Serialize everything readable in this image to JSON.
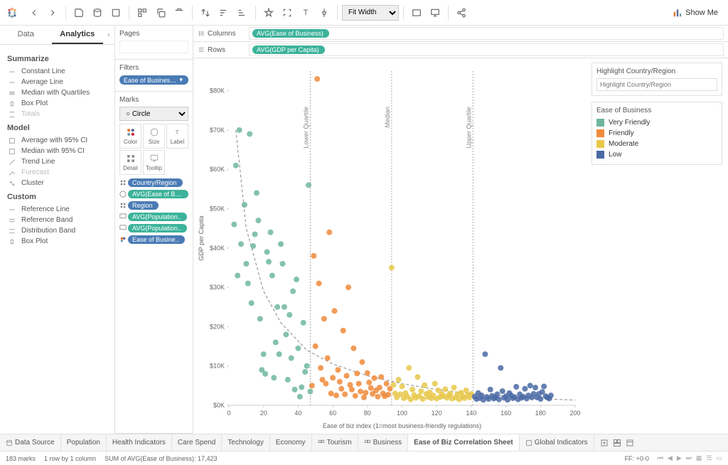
{
  "toolbar": {
    "fit_select": "Fit Width",
    "showme": "Show Me"
  },
  "left_tabs": {
    "data": "Data",
    "analytics": "Analytics"
  },
  "analytics": {
    "summarize": {
      "title": "Summarize",
      "items": [
        "Constant Line",
        "Average Line",
        "Median with Quartiles",
        "Box Plot",
        "Totals"
      ]
    },
    "model": {
      "title": "Model",
      "items": [
        "Average with 95% CI",
        "Median with 95% CI",
        "Trend Line",
        "Forecast",
        "Cluster"
      ]
    },
    "custom": {
      "title": "Custom",
      "items": [
        "Reference Line",
        "Reference Band",
        "Distribution Band",
        "Box Plot"
      ]
    }
  },
  "panels": {
    "pages": "Pages",
    "filters": "Filters",
    "filter_pill": "Ease of Business (cl..",
    "marks": "Marks",
    "mark_type": "Circle",
    "mark_cells": [
      "Color",
      "Size",
      "Label",
      "Detail",
      "Tooltip"
    ],
    "mark_pills": [
      {
        "color": "blue",
        "label": "Country/Region",
        "ind": "detail"
      },
      {
        "color": "green",
        "label": "AVG(Ease of Busi..",
        "ind": "size"
      },
      {
        "color": "blue",
        "label": "Region",
        "ind": "detail"
      },
      {
        "color": "green",
        "label": "AVG(Population..",
        "ind": "tooltip"
      },
      {
        "color": "green",
        "label": "AVG(Population..",
        "ind": "tooltip"
      },
      {
        "color": "blue",
        "label": "Ease of Busine..",
        "ind": "color"
      }
    ]
  },
  "shelves": {
    "columns": "Columns",
    "rows": "Rows",
    "col_pill": "AVG(Ease of Business)",
    "row_pill": "AVG(GDP per Capita)"
  },
  "right": {
    "highlight_title": "Highlight Country/Region",
    "highlight_placeholder": "Highlight Country/Region",
    "legend_title": "Ease of Business",
    "legend": [
      {
        "label": "Very Friendly",
        "color": "#6fb79c"
      },
      {
        "label": "Friendly",
        "color": "#f08a3a"
      },
      {
        "label": "Moderate",
        "color": "#e8c84a"
      },
      {
        "label": "Low",
        "color": "#4a6aa5"
      }
    ]
  },
  "sheet_tabs": {
    "data_source": "Data Source",
    "items": [
      "Population",
      "Health Indicators",
      "Care Spend",
      "Technology",
      "Economy",
      "Tourism",
      "Business",
      "Ease of Biz Correlation Sheet",
      "Global Indicators"
    ],
    "active_index": 7
  },
  "status": {
    "marks": "183 marks",
    "rbc": "1 row by 1 column",
    "sum": "SUM of AVG(Ease of Business): 17,423",
    "ff": "FF: +0-0"
  },
  "chart_data": {
    "type": "scatter",
    "xlabel": "Ease of biz index (1=most business-friendly regulations)",
    "ylabel": "GDP per Capita",
    "xlim": [
      0,
      200
    ],
    "ylim": [
      0,
      85000
    ],
    "yticks": [
      0,
      10000,
      20000,
      30000,
      40000,
      50000,
      60000,
      70000,
      80000
    ],
    "ytick_labels": [
      "$0K",
      "$10K",
      "$20K",
      "$30K",
      "$40K",
      "$50K",
      "$60K",
      "$70K",
      "$80K"
    ],
    "xticks": [
      0,
      20,
      40,
      60,
      80,
      100,
      120,
      140,
      160,
      180,
      200
    ],
    "reference_lines": [
      {
        "x": 47,
        "label": "Lower Quartile"
      },
      {
        "x": 94,
        "label": "Median"
      },
      {
        "x": 141,
        "label": "Upper Quartile"
      }
    ],
    "trend": [
      {
        "x": 4,
        "y": 70000
      },
      {
        "x": 10,
        "y": 45000
      },
      {
        "x": 20,
        "y": 29000
      },
      {
        "x": 30,
        "y": 21000
      },
      {
        "x": 45,
        "y": 14000
      },
      {
        "x": 60,
        "y": 10500
      },
      {
        "x": 80,
        "y": 7500
      },
      {
        "x": 100,
        "y": 5500
      },
      {
        "x": 120,
        "y": 4000
      },
      {
        "x": 140,
        "y": 3000
      },
      {
        "x": 160,
        "y": 2300
      },
      {
        "x": 180,
        "y": 1700
      },
      {
        "x": 200,
        "y": 1300
      }
    ],
    "series": [
      {
        "name": "Very Friendly",
        "color": "#6fb79c",
        "points": [
          {
            "x": 3,
            "y": 46000
          },
          {
            "x": 4,
            "y": 61000
          },
          {
            "x": 5,
            "y": 33000
          },
          {
            "x": 6,
            "y": 70000
          },
          {
            "x": 7,
            "y": 41000
          },
          {
            "x": 9,
            "y": 51000
          },
          {
            "x": 10,
            "y": 36000
          },
          {
            "x": 11,
            "y": 31000
          },
          {
            "x": 12,
            "y": 69000
          },
          {
            "x": 13,
            "y": 26000
          },
          {
            "x": 14,
            "y": 40500
          },
          {
            "x": 15,
            "y": 43500
          },
          {
            "x": 16,
            "y": 54000
          },
          {
            "x": 17,
            "y": 47000
          },
          {
            "x": 18,
            "y": 22000
          },
          {
            "x": 19,
            "y": 9000
          },
          {
            "x": 20,
            "y": 13000
          },
          {
            "x": 21,
            "y": 8000
          },
          {
            "x": 22,
            "y": 39000
          },
          {
            "x": 23,
            "y": 36500
          },
          {
            "x": 24,
            "y": 44000
          },
          {
            "x": 25,
            "y": 33000
          },
          {
            "x": 26,
            "y": 7000
          },
          {
            "x": 27,
            "y": 16000
          },
          {
            "x": 28,
            "y": 25000
          },
          {
            "x": 29,
            "y": 13000
          },
          {
            "x": 30,
            "y": 41000
          },
          {
            "x": 31,
            "y": 36000
          },
          {
            "x": 32,
            "y": 25000
          },
          {
            "x": 33,
            "y": 18000
          },
          {
            "x": 34,
            "y": 6500
          },
          {
            "x": 35,
            "y": 23000
          },
          {
            "x": 36,
            "y": 12000
          },
          {
            "x": 37,
            "y": 29000
          },
          {
            "x": 38,
            "y": 4000
          },
          {
            "x": 39,
            "y": 32000
          },
          {
            "x": 40,
            "y": 14500
          },
          {
            "x": 41,
            "y": 2200
          },
          {
            "x": 42,
            "y": 4600
          },
          {
            "x": 43,
            "y": 21000
          },
          {
            "x": 44,
            "y": 8500
          },
          {
            "x": 45,
            "y": 10000
          },
          {
            "x": 46,
            "y": 56000
          },
          {
            "x": 47,
            "y": 3500
          }
        ]
      },
      {
        "name": "Friendly",
        "color": "#f08a3a",
        "points": [
          {
            "x": 48,
            "y": 5000
          },
          {
            "x": 49,
            "y": 38000
          },
          {
            "x": 50,
            "y": 15000
          },
          {
            "x": 51,
            "y": 83000
          },
          {
            "x": 52,
            "y": 31000
          },
          {
            "x": 53,
            "y": 9500
          },
          {
            "x": 54,
            "y": 6500
          },
          {
            "x": 55,
            "y": 22000
          },
          {
            "x": 56,
            "y": 5500
          },
          {
            "x": 57,
            "y": 12000
          },
          {
            "x": 58,
            "y": 44000
          },
          {
            "x": 59,
            "y": 3000
          },
          {
            "x": 60,
            "y": 7000
          },
          {
            "x": 61,
            "y": 24000
          },
          {
            "x": 62,
            "y": 2500
          },
          {
            "x": 63,
            "y": 9000
          },
          {
            "x": 64,
            "y": 6000
          },
          {
            "x": 65,
            "y": 4200
          },
          {
            "x": 66,
            "y": 19000
          },
          {
            "x": 67,
            "y": 2800
          },
          {
            "x": 68,
            "y": 7500
          },
          {
            "x": 69,
            "y": 30000
          },
          {
            "x": 70,
            "y": 5200
          },
          {
            "x": 71,
            "y": 4000
          },
          {
            "x": 72,
            "y": 14500
          },
          {
            "x": 73,
            "y": 2400
          },
          {
            "x": 74,
            "y": 8100
          },
          {
            "x": 75,
            "y": 5500
          },
          {
            "x": 76,
            "y": 3500
          },
          {
            "x": 77,
            "y": 11000
          },
          {
            "x": 78,
            "y": 2000
          },
          {
            "x": 79,
            "y": 3200
          },
          {
            "x": 80,
            "y": 8200
          },
          {
            "x": 81,
            "y": 5800
          },
          {
            "x": 82,
            "y": 4400
          },
          {
            "x": 83,
            "y": 2900
          },
          {
            "x": 84,
            "y": 6900
          },
          {
            "x": 85,
            "y": 3800
          },
          {
            "x": 86,
            "y": 2200
          },
          {
            "x": 87,
            "y": 4500
          },
          {
            "x": 88,
            "y": 7200
          },
          {
            "x": 89,
            "y": 3000
          },
          {
            "x": 90,
            "y": 2300
          },
          {
            "x": 91,
            "y": 5500
          },
          {
            "x": 92,
            "y": 2700
          },
          {
            "x": 93,
            "y": 4200
          }
        ]
      },
      {
        "name": "Moderate",
        "color": "#e8c84a",
        "points": [
          {
            "x": 94,
            "y": 35000
          },
          {
            "x": 95,
            "y": 5200
          },
          {
            "x": 96,
            "y": 3000
          },
          {
            "x": 97,
            "y": 2000
          },
          {
            "x": 98,
            "y": 6500
          },
          {
            "x": 99,
            "y": 2800
          },
          {
            "x": 100,
            "y": 4800
          },
          {
            "x": 101,
            "y": 1800
          },
          {
            "x": 102,
            "y": 3100
          },
          {
            "x": 103,
            "y": 2200
          },
          {
            "x": 104,
            "y": 9500
          },
          {
            "x": 105,
            "y": 1500
          },
          {
            "x": 106,
            "y": 4000
          },
          {
            "x": 107,
            "y": 2600
          },
          {
            "x": 108,
            "y": 1900
          },
          {
            "x": 109,
            "y": 7200
          },
          {
            "x": 110,
            "y": 2300
          },
          {
            "x": 111,
            "y": 3600
          },
          {
            "x": 112,
            "y": 1600
          },
          {
            "x": 113,
            "y": 5100
          },
          {
            "x": 114,
            "y": 2900
          },
          {
            "x": 115,
            "y": 2100
          },
          {
            "x": 116,
            "y": 3300
          },
          {
            "x": 117,
            "y": 1800
          },
          {
            "x": 118,
            "y": 2500
          },
          {
            "x": 119,
            "y": 5500
          },
          {
            "x": 120,
            "y": 1700
          },
          {
            "x": 121,
            "y": 3800
          },
          {
            "x": 122,
            "y": 2100
          },
          {
            "x": 123,
            "y": 2900
          },
          {
            "x": 124,
            "y": 2300
          },
          {
            "x": 125,
            "y": 4100
          },
          {
            "x": 126,
            "y": 1900
          },
          {
            "x": 127,
            "y": 2600
          },
          {
            "x": 128,
            "y": 3000
          },
          {
            "x": 129,
            "y": 1700
          },
          {
            "x": 130,
            "y": 4500
          },
          {
            "x": 131,
            "y": 2000
          },
          {
            "x": 132,
            "y": 2800
          },
          {
            "x": 133,
            "y": 1500
          },
          {
            "x": 134,
            "y": 3200
          },
          {
            "x": 135,
            "y": 2300
          },
          {
            "x": 136,
            "y": 1800
          },
          {
            "x": 137,
            "y": 3800
          },
          {
            "x": 138,
            "y": 2600
          },
          {
            "x": 139,
            "y": 2000
          },
          {
            "x": 140,
            "y": 2900
          }
        ]
      },
      {
        "name": "Low",
        "color": "#4a6aa5",
        "points": [
          {
            "x": 142,
            "y": 2200
          },
          {
            "x": 143,
            "y": 1600
          },
          {
            "x": 144,
            "y": 3100
          },
          {
            "x": 145,
            "y": 1800
          },
          {
            "x": 146,
            "y": 2500
          },
          {
            "x": 147,
            "y": 1400
          },
          {
            "x": 148,
            "y": 13000
          },
          {
            "x": 149,
            "y": 2100
          },
          {
            "x": 150,
            "y": 1600
          },
          {
            "x": 151,
            "y": 4000
          },
          {
            "x": 152,
            "y": 2400
          },
          {
            "x": 153,
            "y": 1700
          },
          {
            "x": 154,
            "y": 2000
          },
          {
            "x": 155,
            "y": 2800
          },
          {
            "x": 156,
            "y": 1500
          },
          {
            "x": 157,
            "y": 9500
          },
          {
            "x": 158,
            "y": 3600
          },
          {
            "x": 159,
            "y": 1900
          },
          {
            "x": 160,
            "y": 2300
          },
          {
            "x": 161,
            "y": 1400
          },
          {
            "x": 162,
            "y": 3100
          },
          {
            "x": 163,
            "y": 2500
          },
          {
            "x": 164,
            "y": 1800
          },
          {
            "x": 165,
            "y": 2100
          },
          {
            "x": 166,
            "y": 4700
          },
          {
            "x": 167,
            "y": 1500
          },
          {
            "x": 168,
            "y": 2800
          },
          {
            "x": 169,
            "y": 1900
          },
          {
            "x": 170,
            "y": 2200
          },
          {
            "x": 171,
            "y": 4200
          },
          {
            "x": 172,
            "y": 1700
          },
          {
            "x": 173,
            "y": 2500
          },
          {
            "x": 174,
            "y": 5000
          },
          {
            "x": 175,
            "y": 2000
          },
          {
            "x": 176,
            "y": 2900
          },
          {
            "x": 177,
            "y": 4500
          },
          {
            "x": 178,
            "y": 2000
          },
          {
            "x": 179,
            "y": 2900
          },
          {
            "x": 180,
            "y": 1600
          },
          {
            "x": 181,
            "y": 3400
          },
          {
            "x": 182,
            "y": 4800
          },
          {
            "x": 183,
            "y": 2300
          },
          {
            "x": 184,
            "y": 2000
          },
          {
            "x": 185,
            "y": 1700
          },
          {
            "x": 186,
            "y": 2500
          }
        ]
      }
    ]
  }
}
